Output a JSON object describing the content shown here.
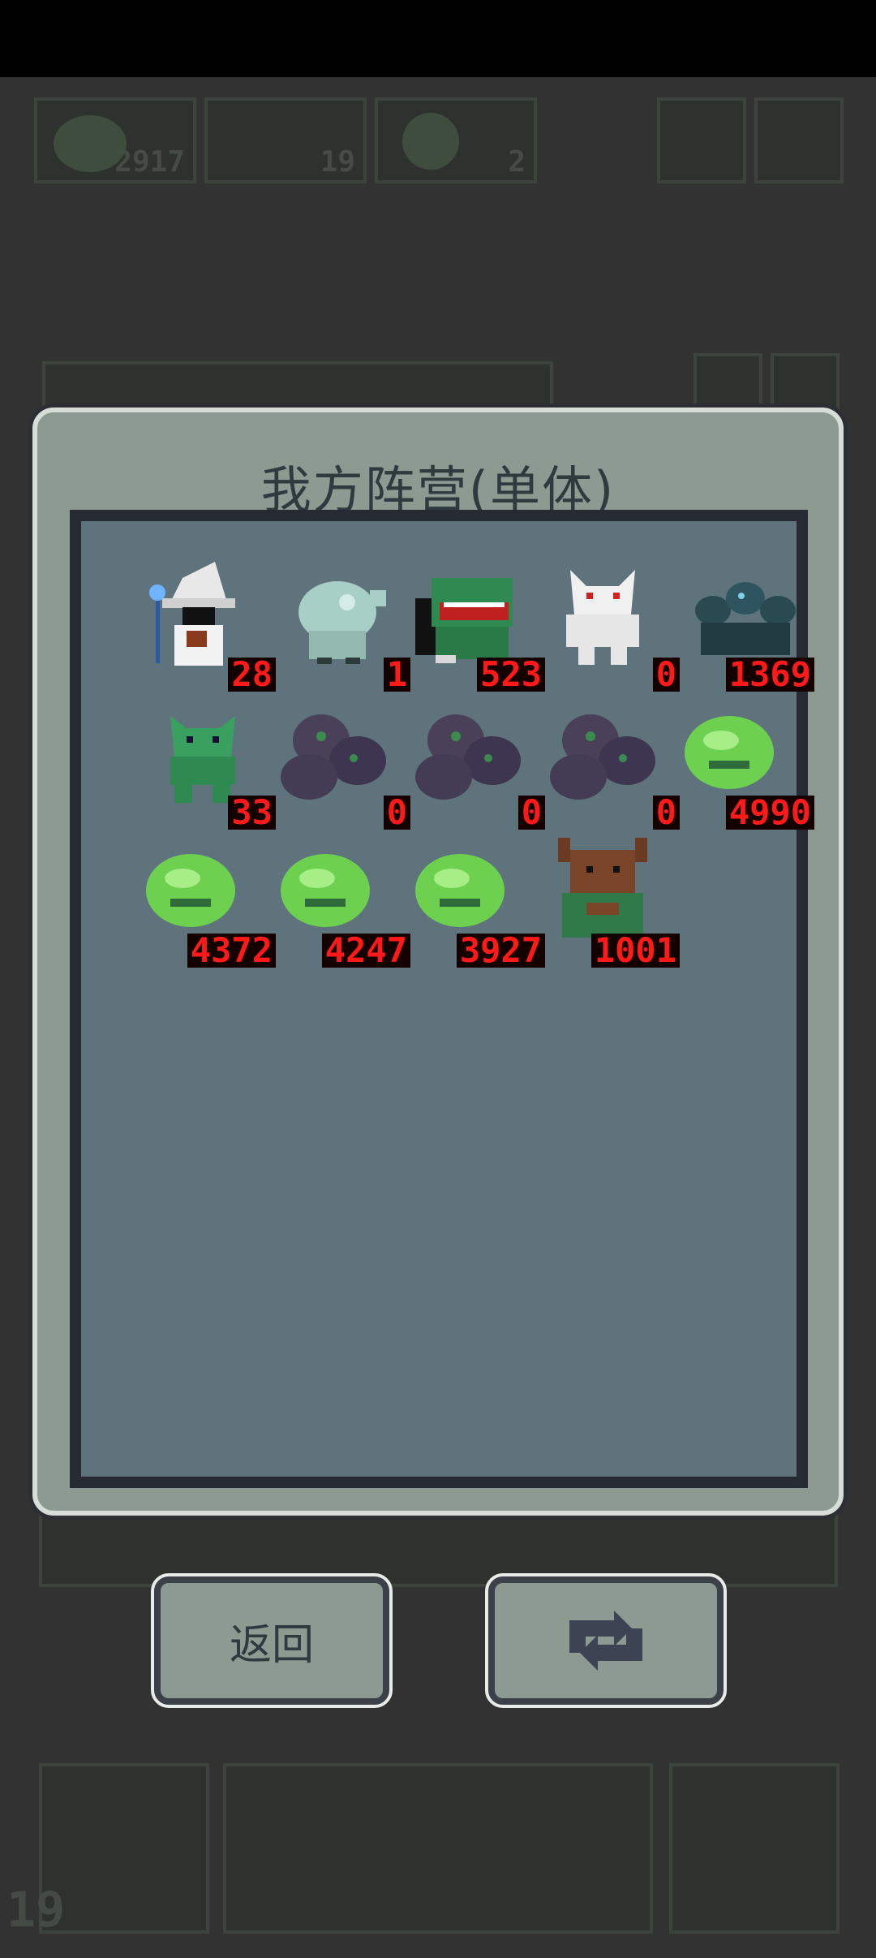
{
  "background": {
    "top_counts": [
      "2917",
      "19",
      "2"
    ],
    "bottom_level": "19"
  },
  "modal": {
    "title": "我方阵营(单体)",
    "units": [
      {
        "icon": "wizard-icon",
        "count": "28"
      },
      {
        "icon": "ghost-fish-icon",
        "count": "1"
      },
      {
        "icon": "green-dragon-icon",
        "count": "523"
      },
      {
        "icon": "white-demon-icon",
        "count": "0"
      },
      {
        "icon": "hydra-icon",
        "count": "1369"
      },
      {
        "icon": "green-goblin-icon",
        "count": "33"
      },
      {
        "icon": "rock-golem-icon",
        "count": "0"
      },
      {
        "icon": "rock-golem-icon",
        "count": "0"
      },
      {
        "icon": "rock-golem-icon",
        "count": "0"
      },
      {
        "icon": "green-slime-icon",
        "count": "4990"
      },
      {
        "icon": "green-slime-icon",
        "count": "4372"
      },
      {
        "icon": "green-slime-icon",
        "count": "4247"
      },
      {
        "icon": "green-slime-icon",
        "count": "3927"
      },
      {
        "icon": "minotaur-icon",
        "count": "1001"
      }
    ]
  },
  "buttons": {
    "back_label": "返回",
    "refresh_icon": "refresh-icon"
  },
  "colors": {
    "count_text": "#ff1a1a",
    "panel": "#5e737c",
    "frame": "#8d9a92"
  }
}
